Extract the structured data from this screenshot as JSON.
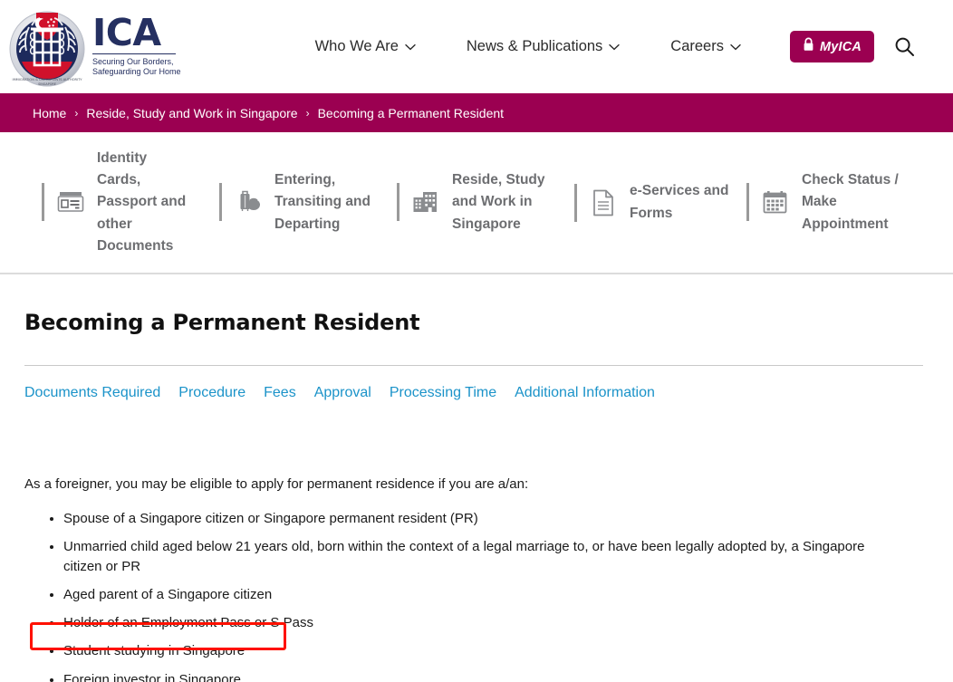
{
  "header": {
    "logo": {
      "crest_name": "ica-crest-logo",
      "wordmark": "ICA",
      "tagline_line1": "Securing Our Borders,",
      "tagline_line2": "Safeguarding Our Home"
    },
    "nav": [
      {
        "label": "Who We Are",
        "icon": "chevron-down-icon"
      },
      {
        "label": "News & Publications",
        "icon": "chevron-down-icon"
      },
      {
        "label": "Careers",
        "icon": "chevron-down-icon"
      }
    ],
    "myica": {
      "label": "MyICA",
      "icon": "lock-icon"
    },
    "search": {
      "icon": "search-icon"
    }
  },
  "breadcrumb": {
    "items": [
      "Home",
      "Reside, Study and Work in Singapore",
      "Becoming a Permanent Resident"
    ],
    "separator": "›"
  },
  "category_nav": [
    {
      "label": "Identity Cards, Passport and other Documents",
      "icon": "id-card-icon"
    },
    {
      "label": "Entering, Transiting and Departing",
      "icon": "luggage-icon"
    },
    {
      "label": "Reside, Study and Work in Singapore",
      "icon": "building-icon"
    },
    {
      "label": "e-Services and Forms",
      "icon": "document-icon"
    },
    {
      "label": "Check Status / Make Appointment",
      "icon": "calendar-icon"
    }
  ],
  "main": {
    "title": "Becoming a Permanent Resident",
    "tabs": [
      "Documents Required",
      "Procedure",
      "Fees",
      "Approval",
      "Processing Time",
      "Additional Information"
    ],
    "intro": "As a foreigner, you may be eligible to apply for permanent residence if you are a/an:",
    "eligibility": [
      "Spouse of a Singapore citizen or Singapore permanent resident (PR)",
      "Unmarried child aged below 21 years old, born within the context of a legal marriage to, or have been legally adopted by, a Singapore citizen or PR",
      "Aged parent of a Singapore citizen",
      "Holder of an Employment Pass or S Pass",
      "Student studying in Singapore",
      "Foreign investor in Singapore."
    ]
  },
  "annotation": {
    "target_text": "Student studying in Singapore",
    "color": "#FF1100"
  },
  "colors": {
    "brand_magenta": "#9B0051",
    "brand_navy": "#253061",
    "link_blue": "#1B93C9",
    "icon_gray": "#6d6e71",
    "annotation_red": "#FF1100"
  }
}
